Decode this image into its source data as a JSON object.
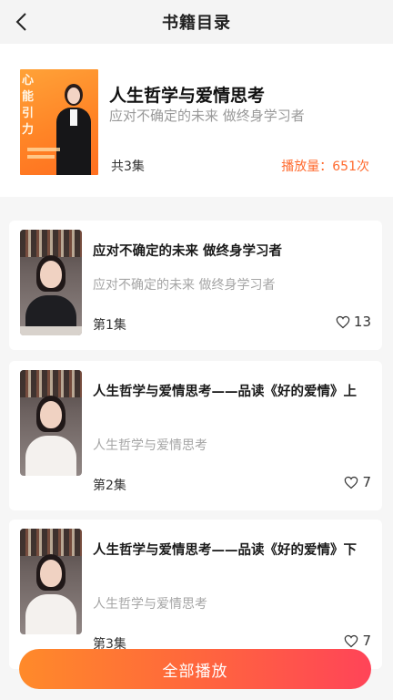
{
  "header": {
    "title": "书籍目录"
  },
  "book": {
    "cover_text": "心能引力",
    "title": "人生哲学与爱情思考",
    "subtitle": "应对不确定的未来 做终身学习者",
    "episodes": "共3集",
    "plays": "播放量：651次"
  },
  "items": [
    {
      "title": "应对不确定的未来 做终身学习者",
      "subtitle": "应对不确定的未来 做终身学习者",
      "episode": "第1集",
      "likes": "13"
    },
    {
      "title": "人生哲学与爱情思考——品读《好的爱情》上",
      "subtitle": "人生哲学与爱情思考",
      "episode": "第2集",
      "likes": "7"
    },
    {
      "title": "人生哲学与爱情思考——品读《好的爱情》下",
      "subtitle": "人生哲学与爱情思考",
      "episode": "第3集",
      "likes": "7"
    }
  ],
  "footer": {
    "play_all": "全部播放"
  },
  "colors": {
    "accent": "#ff6a2e",
    "gradient_start": "#ff8a2a",
    "gradient_end": "#ff4458"
  }
}
